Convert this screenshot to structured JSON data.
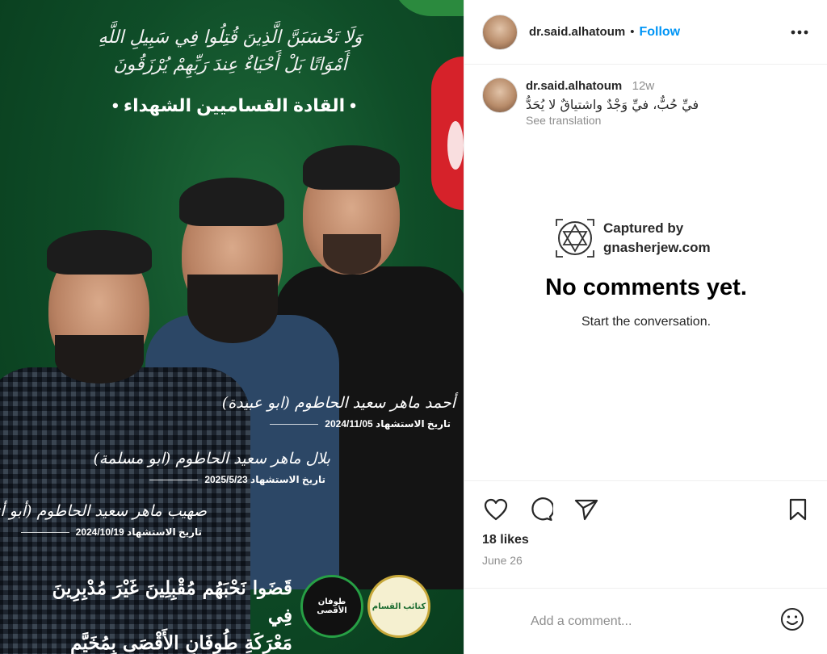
{
  "poster": {
    "calligraphy": "وَلَا تَحْسَبَنَّ الَّذِينَ قُتِلُوا فِي سَبِيلِ اللَّهِ أَمْوَاتًا بَلْ أَحْيَاءٌ عِندَ رَبِّهِمْ يُرْزَقُونَ",
    "heading": "• القادة القساميين الشهداء •",
    "martyrs": [
      {
        "name": "أحمد ماهر سعيد الحاطوم (ابو عبيدة)",
        "date": "تاريخ الاستشهاد 2024/11/05"
      },
      {
        "name": "بلال ماهر سعيد الحاطوم (ابو مسلمة)",
        "date": "تاريخ الاستشهاد 2025/5/23"
      },
      {
        "name": "صهيب ماهر سعيد الحاطوم (أبو أنس)",
        "date": "تاريخ الاستشهاد 2024/10/19"
      }
    ],
    "slogan_line1": "قَضَوا نَحْبَهُم مُقْبِلِينَ غَيْرَ مُدْبِرِينَ فِي",
    "slogan_line2": "مَعْرَكَةِ طُوفَانِ الأَقْصَى بِمُخَيَّمِ جَبَالِيَا",
    "logo_left": "طوفان الأقصى",
    "logo_right": "كتائب القسام"
  },
  "header": {
    "username": "dr.said.alhatoum",
    "separator": "•",
    "follow_label": "Follow",
    "more_label": "•••"
  },
  "caption": {
    "username": "dr.said.alhatoum",
    "age": "12w",
    "text": "فيِّ حُبٌّ، فيِّ وَجْدٌ واشتياقٌ لا يُحَدُّ",
    "see_translation": "See translation"
  },
  "watermark": {
    "line1": "Captured by",
    "line2": "gnasherjew.com"
  },
  "comments": {
    "empty_title": "No comments yet.",
    "empty_sub": "Start the conversation."
  },
  "actions": {
    "likes": "18 likes",
    "date": "June 26"
  },
  "add_comment": {
    "placeholder": "Add a comment..."
  },
  "icons": [
    "heart-icon",
    "comment-icon",
    "share-icon",
    "bookmark-icon",
    "emoji-icon",
    "more-icon"
  ]
}
